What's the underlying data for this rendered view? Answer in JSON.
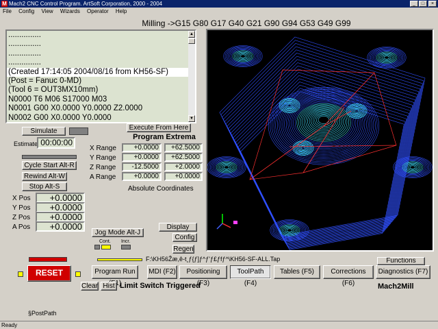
{
  "window": {
    "title": "Mach2 CNC Control Program. ArtSoft Corporation, 2000 - 2004",
    "app_icon": "M",
    "minimize": "_",
    "maximize": "□",
    "close": "×"
  },
  "menu": [
    "File",
    "Config",
    "View",
    "Wizards",
    "Operator",
    "Help"
  ],
  "modal_line": "Milling ->G15  G80 G17 G40 G21 G90 G94 G53 G49 G99 G64",
  "gcode": {
    "lines": [
      "...............",
      "...............",
      "...............",
      "...............",
      "(Created 17:14:05 2004/08/16 from KH56-SF)",
      "(Post = Fanuc 0-MD)",
      "(Tool 6 = OUT3MX10mm)",
      "N0000 T6 M06 S17000 M03",
      "N0001 G00 X0.0000 Y0.0000 Z2.0000",
      "N0002 G00 X0.0000 Y0.0000"
    ],
    "selected_index": 4
  },
  "controls": {
    "simulate": "Simulate",
    "estimate_label": "Estimate",
    "estimate_value": "00:00:00",
    "cycle_start": "Cycle Start Alt-R",
    "rewind": "Rewind Alt-W",
    "stop": "Stop Alt-S",
    "execute_from_here": "Execute From Here",
    "jog_mode": "Jog Mode Alt-J",
    "jog_cont": "Cont.",
    "jog_incr": "Incr.",
    "display": "Display",
    "config": "Config",
    "regen": "Regen",
    "reset": "RESET",
    "clear": "Clear",
    "hist": "Hist",
    "functions": "Functions"
  },
  "positions": [
    {
      "label": "X Pos",
      "value": "+0.0000"
    },
    {
      "label": "Y Pos",
      "value": "+0.0000"
    },
    {
      "label": "Z Pos",
      "value": "+0.0000"
    },
    {
      "label": "A Pos",
      "value": "+0.0000"
    }
  ],
  "extrema": {
    "title": "Program Extrema",
    "rows": [
      {
        "label": "X Range",
        "min": "+0.0000",
        "max": "+62.5000"
      },
      {
        "label": "Y Range",
        "min": "+0.0000",
        "max": "+62.5000"
      },
      {
        "label": "Z Range",
        "min": "-12.5000",
        "max": "+2.0000"
      },
      {
        "label": "A Range",
        "min": "+0.0000",
        "max": "+0.0000"
      }
    ],
    "footer": "Absolute Coordinates"
  },
  "file_path": "F:\\KH56Žæ,ê-t¸ƒ{ƒ]ƒ^ƒ'ƒ£ƒfƒ^\\KH56-SF-ALL.Tap",
  "tabs": [
    {
      "label": "Program Run (F1)",
      "active": false
    },
    {
      "label": "MDI (F2)",
      "active": false
    },
    {
      "label": "Positioning (F3)",
      "active": false
    },
    {
      "label": "ToolPath (F4)",
      "active": true
    },
    {
      "label": "Tables (F5)",
      "active": false
    },
    {
      "label": "Corrections (F6)",
      "active": false
    },
    {
      "label": "Diagnostics (F7)",
      "active": false
    }
  ],
  "status_message": "Limit Switch Triggered",
  "profile_name": "Mach2Mill",
  "post_path": "§PostPath",
  "statusbar": "Ready",
  "colors": {
    "titlebar": "#0a246a",
    "dro_bg": "#dce3d0",
    "reset_button": "#d00000",
    "led_yellow": "#ffff00",
    "led_green": "#00c000",
    "toolpath_bg": "#000000",
    "toolpath_lines": "#3050ff",
    "toolpath_highlight": "#40e0ff",
    "toolpath_rapid": "#ff3030"
  }
}
